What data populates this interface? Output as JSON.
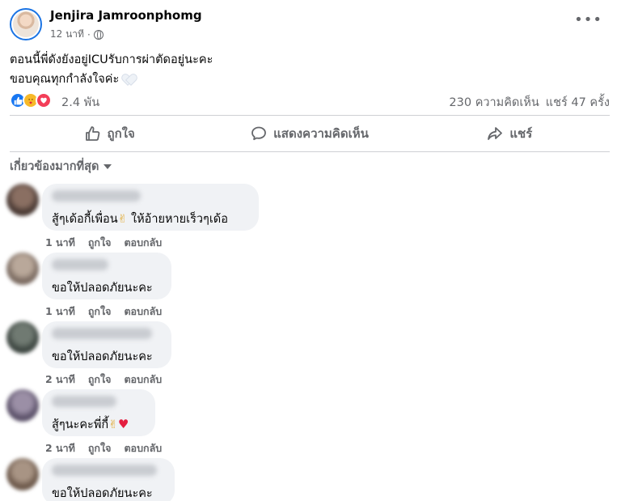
{
  "post": {
    "author": "Jenjira Jamroonphomg",
    "time": "12 นาที",
    "dot": "·",
    "line1": "ตอนนี้พี่ดังยังอยู่ICUรับการผ่าตัดอยู่นะคะ",
    "line2": "ขอบคุณทุกกำลังใจค่ะ",
    "more": "•••"
  },
  "stats": {
    "reactions": "2.4 พัน",
    "comments": "230 ความคิดเห็น",
    "shares": "แชร์ 47 ครั้ง"
  },
  "actions": {
    "like": "ถูกใจ",
    "comment": "แสดงความคิดเห็น",
    "share": "แชร์"
  },
  "sort": {
    "label": "เกี่ยวข้องมากที่สุด"
  },
  "comment_actions": {
    "like": "ถูกใจ",
    "reply": "ตอบกลับ"
  },
  "comments": [
    {
      "text": "สู้ๆเด้อกี้เพื่อน",
      "text2": "ให้อ้ายหายเร็วๆเด้อ",
      "time": "1 นาที"
    },
    {
      "text": "ขอให้ปลอดภัยนะคะ",
      "time": "1 นาที"
    },
    {
      "text": "ขอให้ปลอดภัยนะคะ",
      "time": "2 นาที"
    },
    {
      "text": "สู้ๆนะคะพี่กี้",
      "time": "2 นาที"
    },
    {
      "text": "ขอให้ปลอดภัยนะคะ"
    }
  ],
  "colors": {
    "accent": "#1877f2",
    "secondary_text": "#65676b",
    "bubble": "#f0f2f5"
  }
}
